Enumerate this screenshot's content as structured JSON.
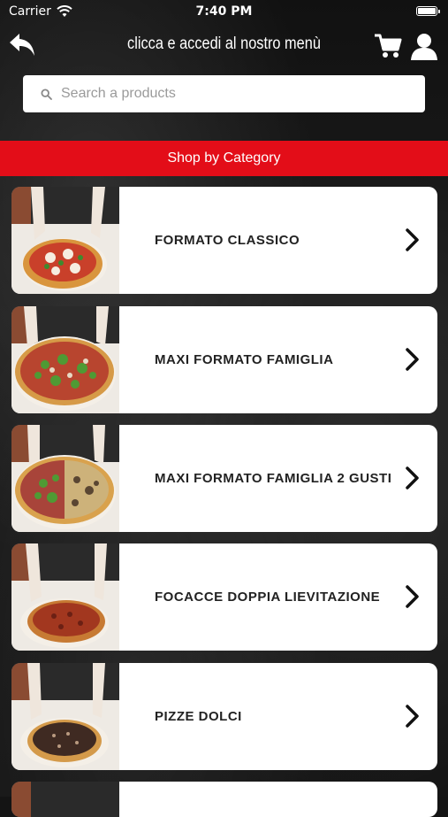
{
  "status_bar": {
    "carrier": "Carrier",
    "time": "7:40 PM"
  },
  "header": {
    "title": "clicca e accedi al nostro menù"
  },
  "search": {
    "placeholder": "Search a products"
  },
  "section": {
    "title": "Shop by Category"
  },
  "categories": [
    {
      "label": "FORMATO CLASSICO",
      "pizza": "margherita"
    },
    {
      "label": "MAXI FORMATO FAMIGLIA",
      "pizza": "rucola"
    },
    {
      "label": "MAXI FORMATO FAMIGLIA 2 GUSTI",
      "pizza": "two-flavors"
    },
    {
      "label": "FOCACCE DOPPIA LIEVITAZIONE",
      "pizza": "focaccia"
    },
    {
      "label": "PIZZE DOLCI",
      "pizza": "nutella"
    }
  ],
  "colors": {
    "accent_red": "#e30d18",
    "card_bg": "#ffffff",
    "text_dark": "#222222"
  }
}
